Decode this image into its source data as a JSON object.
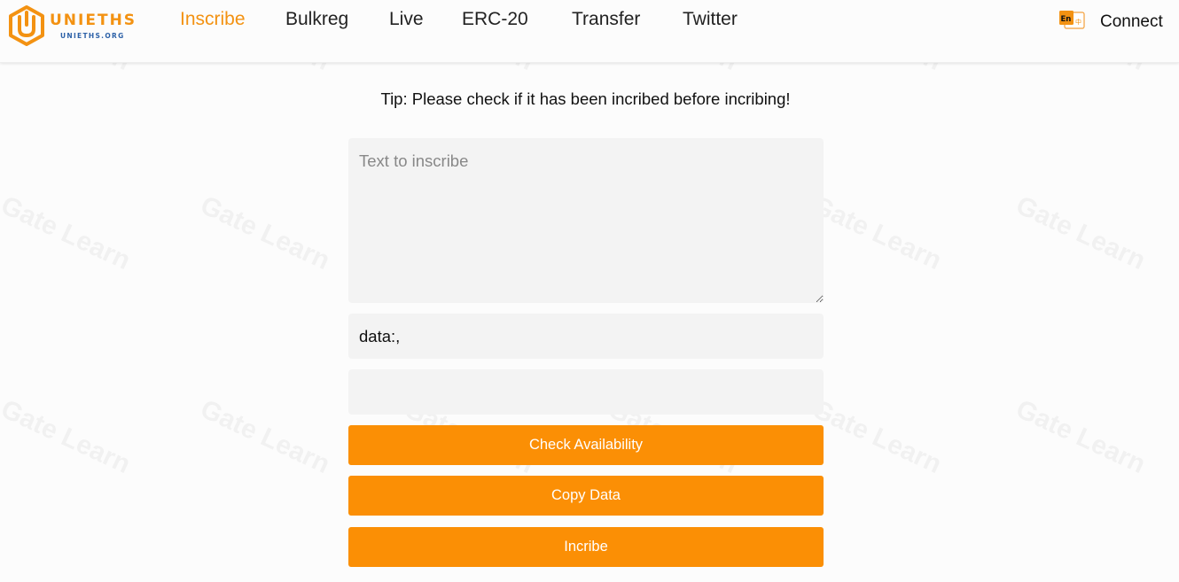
{
  "brand": {
    "name": "UNIETHS",
    "domain": "UNIETHS.ORG",
    "icon": "unieths-logo-icon",
    "accent_color": "#f39212",
    "domain_color": "#2e62a8"
  },
  "nav": {
    "items": [
      {
        "label": "Inscribe",
        "active": true
      },
      {
        "label": "Bulkreg",
        "active": false
      },
      {
        "label": "Live",
        "active": false
      },
      {
        "label": "ERC-20",
        "active": false
      },
      {
        "label": "Transfer",
        "active": false
      },
      {
        "label": "Twitter",
        "active": false
      }
    ],
    "language": {
      "icon": "language-switch-icon",
      "primary": "En",
      "secondary": "中"
    },
    "connect_label": "Connect"
  },
  "watermark": {
    "text": "Gate Learn"
  },
  "main": {
    "tip": "Tip: Please check if it has been incribed before incribing!",
    "text_input": {
      "placeholder": "Text to inscribe",
      "value": ""
    },
    "data_field": {
      "value": "data:,"
    },
    "extra_field": {
      "value": ""
    },
    "buttons": {
      "check": "Check Availability",
      "copy": "Copy Data",
      "inscribe": "Incribe"
    },
    "button_color": "#fb8f05",
    "field_color": "#f3f3f3"
  }
}
